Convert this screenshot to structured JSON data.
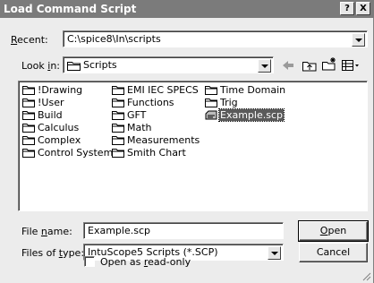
{
  "window": {
    "title": "Load Command Script",
    "help_label": "?",
    "close_label": "X"
  },
  "recent": {
    "label_pre": "",
    "label_key": "R",
    "label_post": "ecent:",
    "value": "C:\\spice8\\In\\scripts"
  },
  "look_in": {
    "label_pre": "Look ",
    "label_key": "i",
    "label_post": "n:",
    "value": "Scripts"
  },
  "toolbar": {
    "back_icon": "back-arrow-icon",
    "up_icon": "up-folder-icon",
    "new_folder_icon": "new-folder-icon",
    "view_menu_icon": "view-menu-icon"
  },
  "files": [
    {
      "name": "!Drawing",
      "type": "folder"
    },
    {
      "name": "!User",
      "type": "folder"
    },
    {
      "name": "Build",
      "type": "folder"
    },
    {
      "name": "Calculus",
      "type": "folder"
    },
    {
      "name": "Complex",
      "type": "folder"
    },
    {
      "name": "Control Systems",
      "type": "folder"
    },
    {
      "name": "EMI IEC SPECS",
      "type": "folder"
    },
    {
      "name": "Functions",
      "type": "folder"
    },
    {
      "name": "GFT",
      "type": "folder"
    },
    {
      "name": "Math",
      "type": "folder"
    },
    {
      "name": "Measurements",
      "type": "folder"
    },
    {
      "name": "Smith Chart",
      "type": "folder"
    },
    {
      "name": "Time Domain",
      "type": "folder"
    },
    {
      "name": "Trig",
      "type": "folder"
    },
    {
      "name": "Example.scp",
      "type": "file",
      "selected": true
    }
  ],
  "file_name": {
    "label_pre": "File ",
    "label_key": "n",
    "label_post": "ame:",
    "value": "Example.scp"
  },
  "file_type": {
    "label_pre": "Files of ",
    "label_key": "t",
    "label_post": "ype:",
    "value": "IntuScope5 Scripts (*.SCP)"
  },
  "read_only": {
    "label_pre": "Open as ",
    "label_key": "r",
    "label_post": "ead-only",
    "checked": false
  },
  "buttons": {
    "open_key": "O",
    "open_rest": "pen",
    "cancel": "Cancel"
  }
}
